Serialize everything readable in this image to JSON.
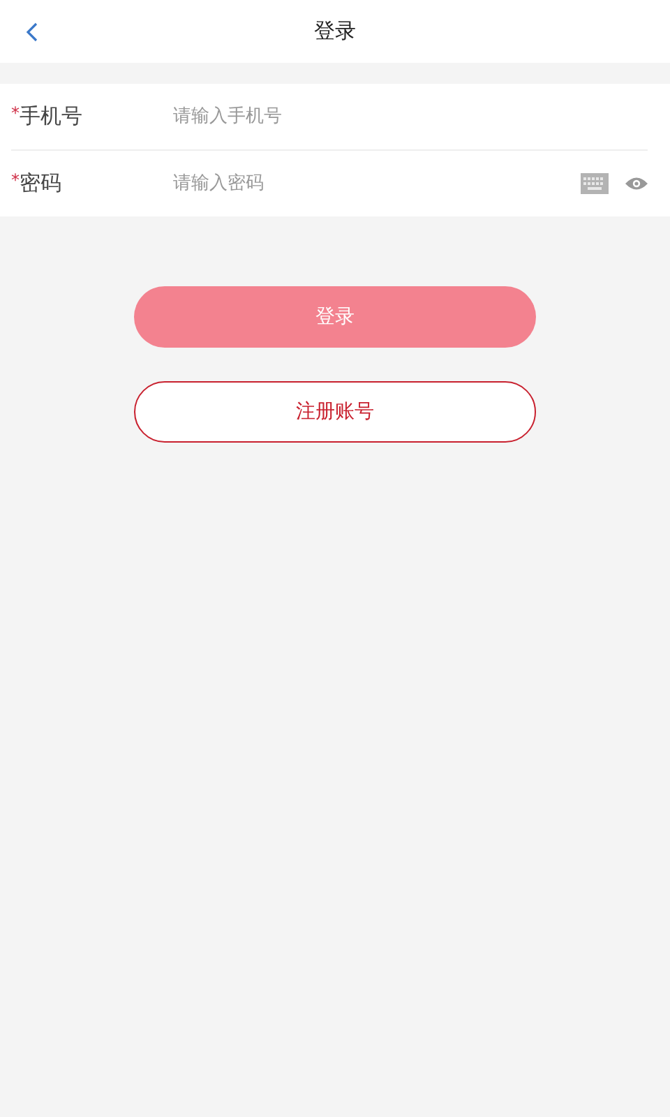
{
  "header": {
    "title": "登录"
  },
  "fields": [
    {
      "required_mark": "*",
      "label": "手机号",
      "placeholder": "请输入手机号",
      "kind": "phone"
    },
    {
      "required_mark": "*",
      "label": "密码",
      "placeholder": "请输入密码",
      "kind": "password"
    }
  ],
  "login_button": {
    "label": "登录",
    "disabled": true
  },
  "register_button": {
    "label": "注册账号"
  }
}
